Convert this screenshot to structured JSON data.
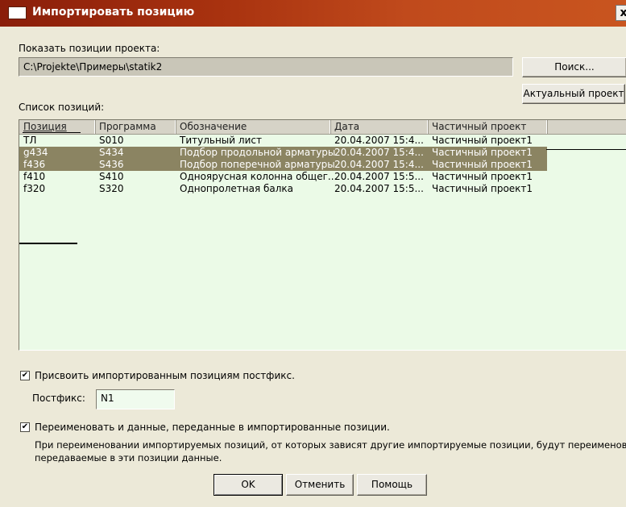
{
  "window": {
    "title": "Импортировать позицию",
    "close_glyph": "x"
  },
  "project": {
    "label": "Показать позиции проекта:",
    "path": "C:\\Projekte\\Примеры\\statik2",
    "search_button": "Поиск...",
    "current_button": "Актуальный проект"
  },
  "list": {
    "label": "Список позиций:",
    "headers": [
      "Позиция",
      "Программа",
      "Обозначение",
      "Дата",
      "Частичный проект"
    ],
    "rows": [
      {
        "pos": "ТЛ",
        "prog": "S010",
        "desc": "Титульный лист",
        "date": "20.04.2007 15:4...",
        "part": "Частичный проект1",
        "selected": false
      },
      {
        "pos": "g434",
        "prog": "S434",
        "desc": "Подбор продольной арматуры",
        "date": "20.04.2007 15:4...",
        "part": "Частичный проект1",
        "selected": true
      },
      {
        "pos": "f436",
        "prog": "S436",
        "desc": "Подбор поперечной арматуры",
        "date": "20.04.2007 15:4...",
        "part": "Частичный проект1",
        "selected": true
      },
      {
        "pos": "f410",
        "prog": "S410",
        "desc": "Одноярусная колонна общег...",
        "date": "20.04.2007 15:5...",
        "part": "Частичный проект1",
        "selected": false
      },
      {
        "pos": "f320",
        "prog": "S320",
        "desc": "Однопролетная балка",
        "date": "20.04.2007 15:5...",
        "part": "Частичный проект1",
        "selected": false
      }
    ]
  },
  "postfix": {
    "checkbox_label": "Присвоить импортированным позициям постфикс.",
    "checked": true,
    "field_label": "Постфикс:",
    "value": "N1"
  },
  "rename": {
    "checkbox_label": "Переименовать и данные, переданные в импортированные позиции.",
    "checked": true,
    "note_line1": "При переименовании импортируемых позиций, от которых зависят другие импортируемые позиции, будут переименованы и",
    "note_line2": "передаваемые в эти позиции данные."
  },
  "buttons": {
    "ok": "OK",
    "cancel": "Отменить",
    "help": "Помощь"
  },
  "colors": {
    "titlebar": "#a8320f",
    "list_bg": "#ebfae7",
    "selection": "#8b8462",
    "dialog_bg": "#ece9d8"
  }
}
